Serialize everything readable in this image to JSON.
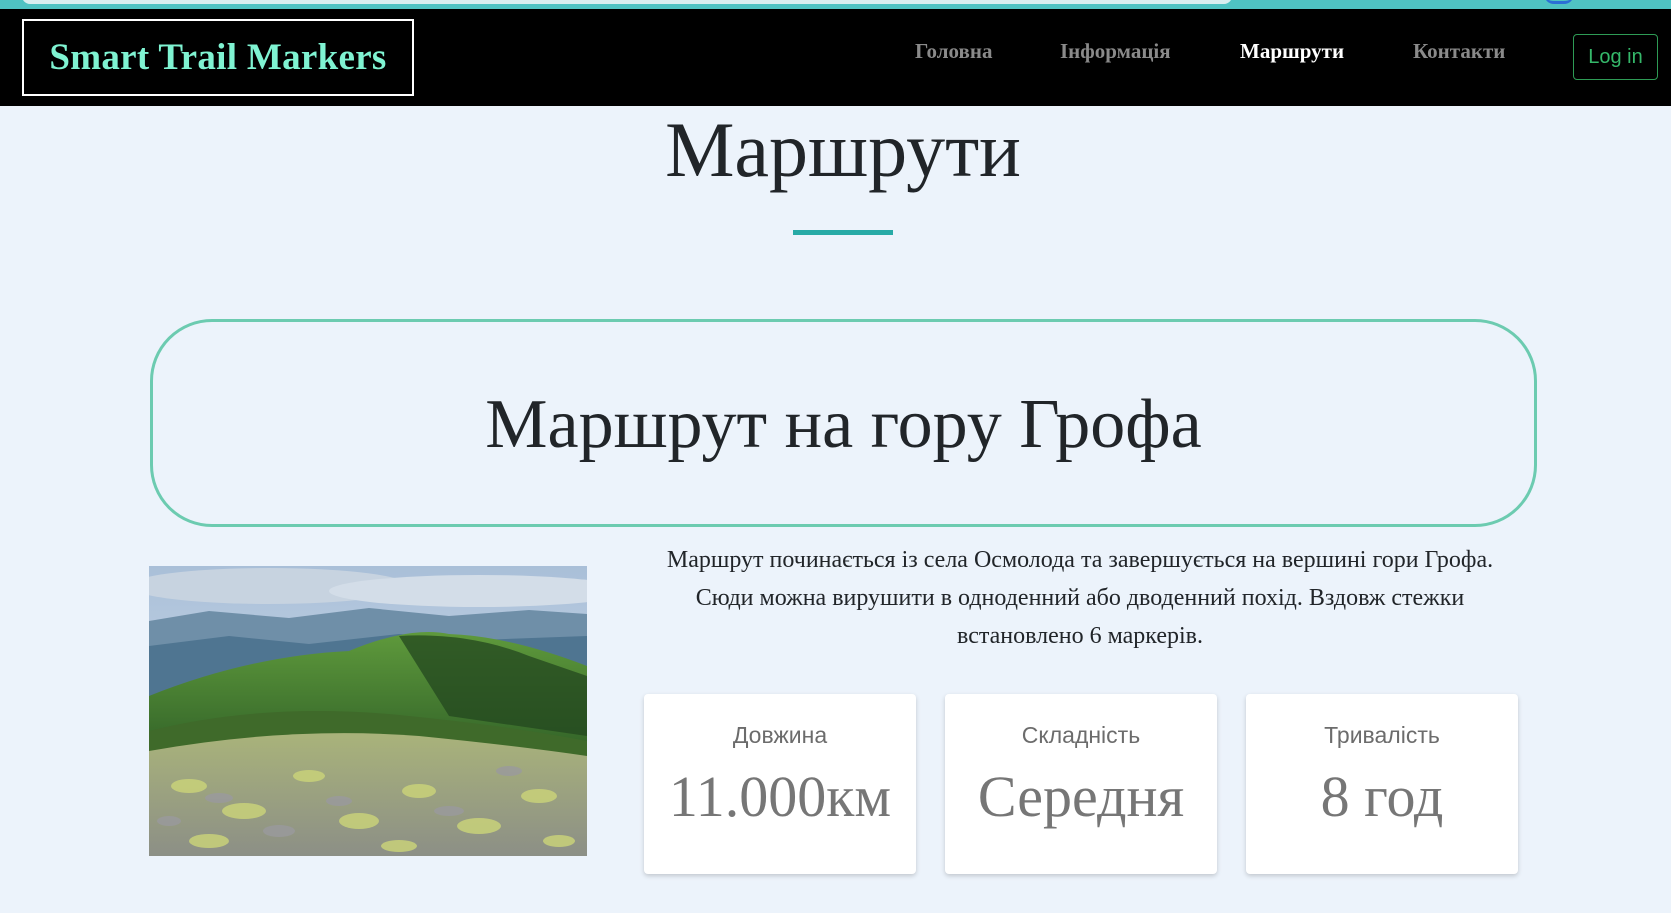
{
  "navbar": {
    "brand": "Smart Trail Markers",
    "links": [
      {
        "label": "Головна",
        "active": false
      },
      {
        "label": "Інформація",
        "active": false
      },
      {
        "label": "Маршрути",
        "active": true
      },
      {
        "label": "Контакти",
        "active": false
      }
    ],
    "login_label": "Log in"
  },
  "page": {
    "title": "Маршрути"
  },
  "route": {
    "title": "Маршрут на гору Грофа",
    "description": "Маршрут починається із села Осмолода та завершується на вершині гори Грофа. Сюди можна вирушити в одноденний або дводенний похід. Вздовж стежки встановлено 6 маркерів.",
    "stats": [
      {
        "label": "Довжина",
        "value": "11.000км"
      },
      {
        "label": "Складність",
        "value": "Середня"
      },
      {
        "label": "Тривалість",
        "value": "8 год"
      }
    ]
  },
  "colors": {
    "brand_text": "#7ff3d2",
    "nav_active": "#ffffff",
    "nav_inactive": "#8a8a8a",
    "accent_teal": "#27aaa6",
    "box_border": "#6ccbb0",
    "login_green": "#35b86a",
    "page_background": "#ecf3fb"
  }
}
